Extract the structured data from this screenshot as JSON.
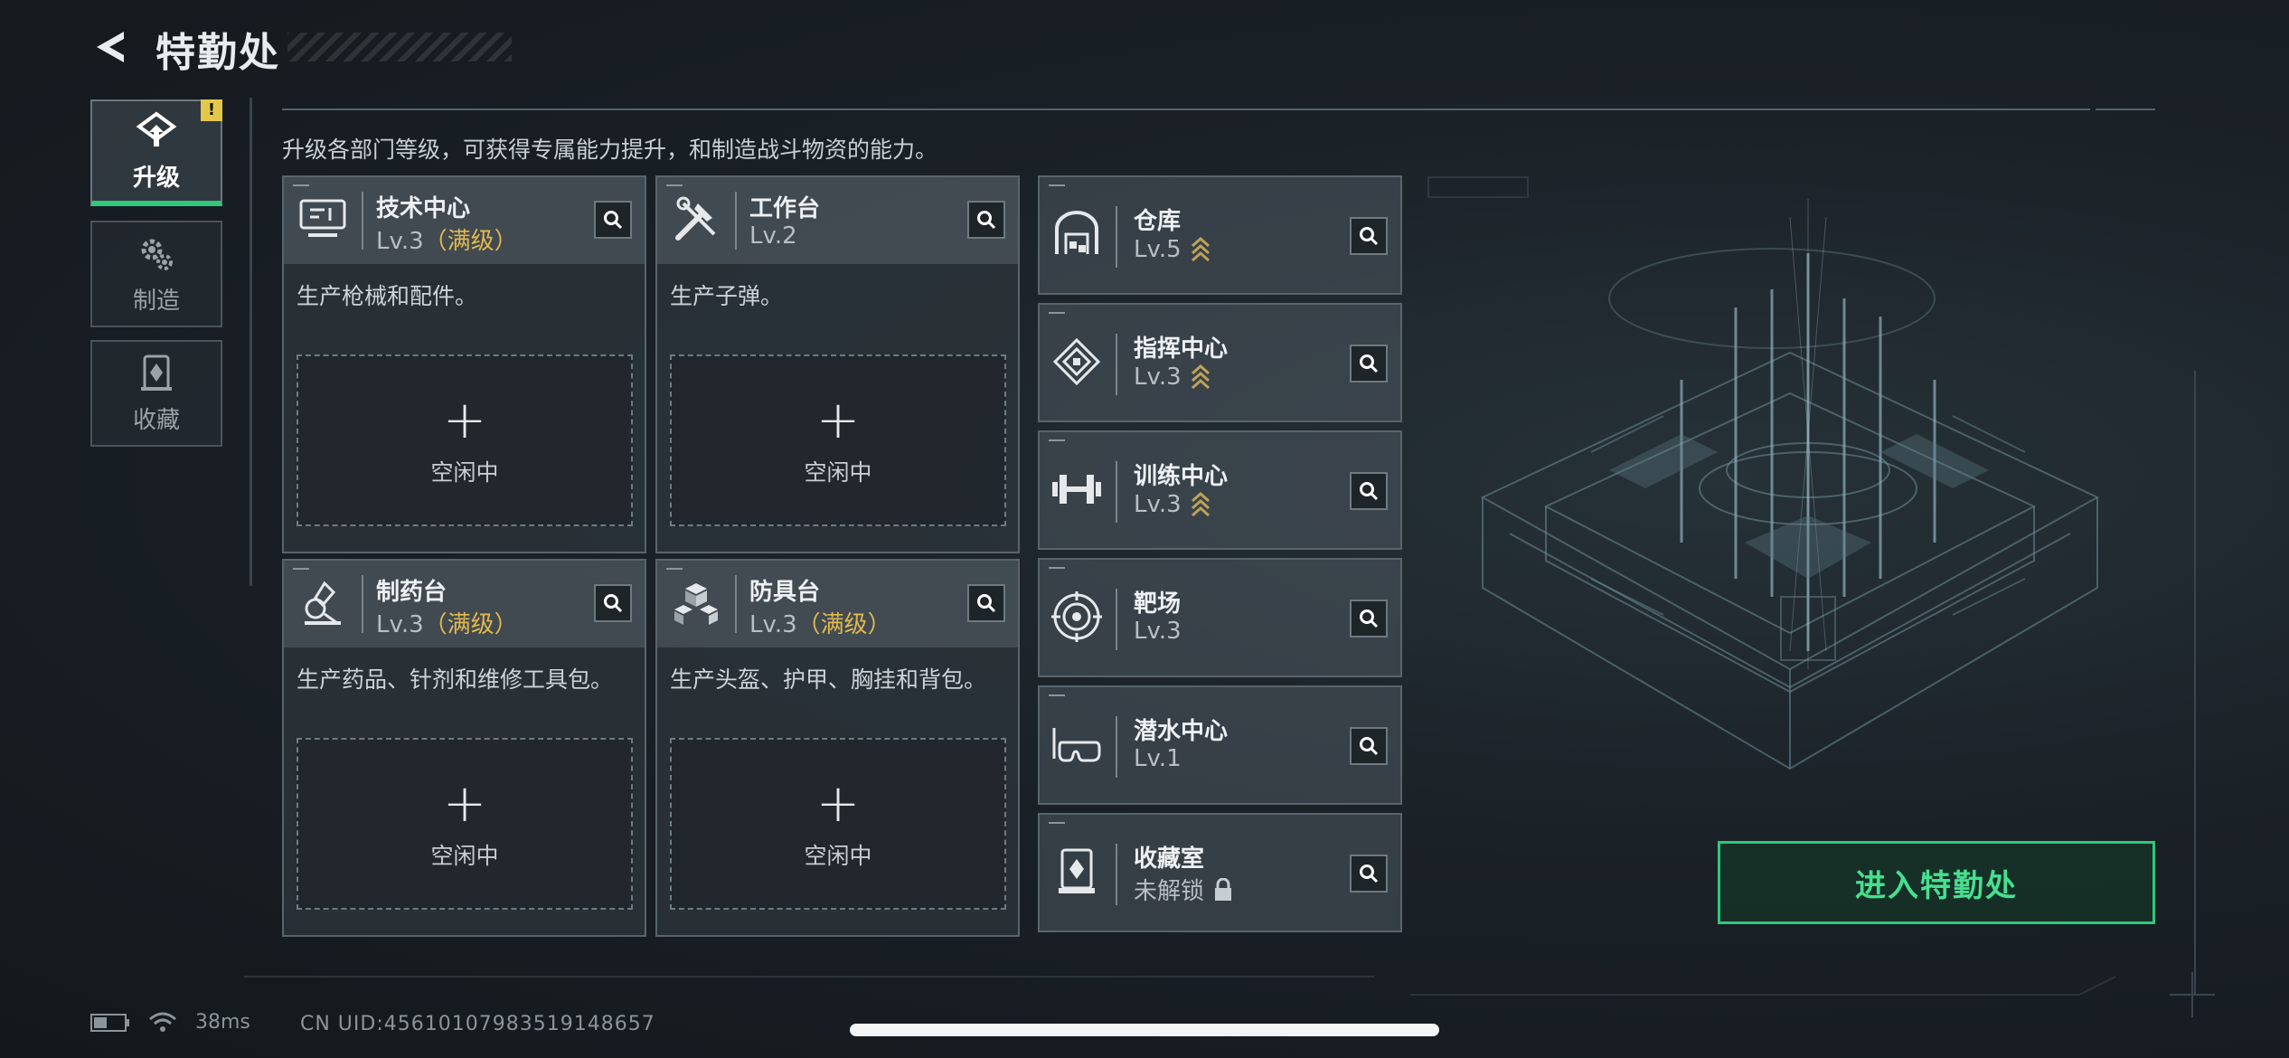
{
  "header": {
    "title": "特勤处"
  },
  "sidebar": {
    "items": [
      {
        "label": "升级",
        "icon": "upgrade-icon",
        "active": true,
        "badge": "!"
      },
      {
        "label": "制造",
        "icon": "gears-icon",
        "active": false
      },
      {
        "label": "收藏",
        "icon": "collection-icon",
        "active": false
      }
    ]
  },
  "description": "升级各部门等级，可获得专属能力提升，和制造战斗物资的能力。",
  "departments": [
    {
      "name": "技术中心",
      "level": "Lv.3",
      "max": "（满级）",
      "desc": "生产枪械和配件。",
      "status": "空闲中",
      "icon": "tech-center-icon"
    },
    {
      "name": "工作台",
      "level": "Lv.2",
      "max": "",
      "desc": "生产子弹。",
      "status": "空闲中",
      "icon": "workbench-icon"
    },
    {
      "name": "制药台",
      "level": "Lv.3",
      "max": "（满级）",
      "desc": "生产药品、针剂和维修工具包。",
      "status": "空闲中",
      "icon": "pharmacy-icon"
    },
    {
      "name": "防具台",
      "level": "Lv.3",
      "max": "（满级）",
      "desc": "生产头盔、护甲、胸挂和背包。",
      "status": "空闲中",
      "icon": "armor-bench-icon"
    }
  ],
  "facilities": [
    {
      "name": "仓库",
      "level": "Lv.5",
      "upgradable": true,
      "icon": "warehouse-icon"
    },
    {
      "name": "指挥中心",
      "level": "Lv.3",
      "upgradable": true,
      "icon": "command-center-icon"
    },
    {
      "name": "训练中心",
      "level": "Lv.3",
      "upgradable": true,
      "icon": "dumbbell-icon"
    },
    {
      "name": "靶场",
      "level": "Lv.3",
      "upgradable": false,
      "icon": "target-icon"
    },
    {
      "name": "潜水中心",
      "level": "Lv.1",
      "upgradable": false,
      "icon": "diving-mask-icon"
    },
    {
      "name": "收藏室",
      "level": "未解锁",
      "upgradable": false,
      "locked": true,
      "icon": "collection-room-icon"
    }
  ],
  "plus_symbol": "+",
  "enter_button": "进入特勤处",
  "statusbar": {
    "ping": "38ms",
    "uid": "CN UID:45610107983519148657"
  },
  "colors": {
    "accent_green": "#2fc879",
    "max_gold": "#e0b84f",
    "badge_yellow": "#e2c84a"
  }
}
